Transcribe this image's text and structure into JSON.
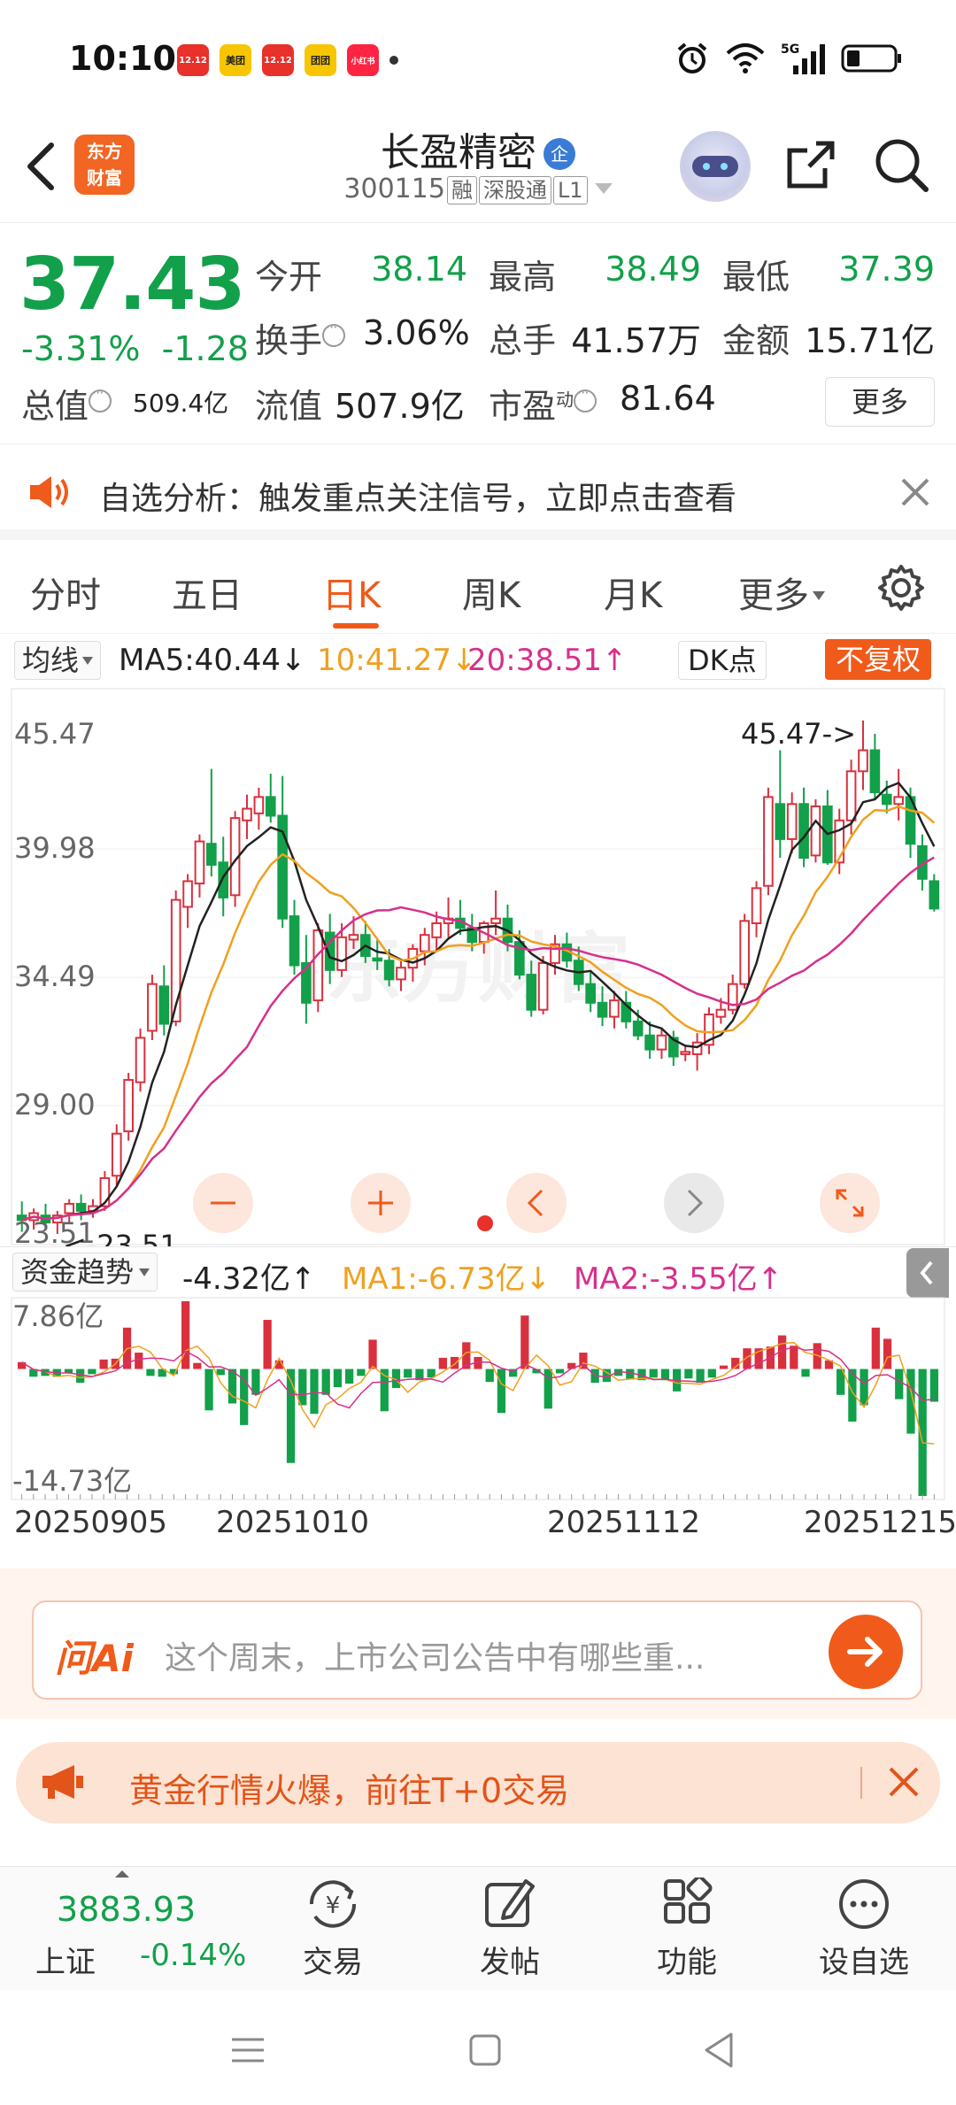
{
  "status_bar": {
    "time": "10:10",
    "app_icons": [
      {
        "name": "app-1212-icon",
        "label": "12.12",
        "color": "#e8312a"
      },
      {
        "name": "meituan-icon",
        "label": "美团",
        "color": "#f7c600"
      },
      {
        "name": "app-1212b-icon",
        "label": "12.12",
        "color": "#e8312a"
      },
      {
        "name": "tuantuan-icon",
        "label": "团团",
        "color": "#f7c600"
      },
      {
        "name": "xiaohongshu-icon",
        "label": "小红书",
        "color": "#ff2442"
      }
    ],
    "network": "5G"
  },
  "header": {
    "logo_line1": "东方",
    "logo_line2": "财富",
    "stock_name": "长盈精密",
    "badge": "企",
    "code": "300115",
    "tags": [
      "融",
      "深股通",
      "L1"
    ]
  },
  "quote": {
    "price": "37.43",
    "change_pct": "-3.31%",
    "change": "-1.28",
    "open_label": "今开",
    "open": "38.14",
    "high_label": "最高",
    "high": "38.49",
    "low_label": "最低",
    "low": "37.39",
    "turnover_label": "换手",
    "turnover": "3.06%",
    "volume_label": "总手",
    "volume": "41.57万",
    "amount_label": "金额",
    "amount": "15.71亿",
    "mktcap_label": "总值",
    "mktcap": "509.4亿",
    "float_label": "流值",
    "float": "507.9亿",
    "pe_label": "市盈",
    "pe_sup": "动",
    "pe": "81.64",
    "more": "更多"
  },
  "alert": {
    "text": "自选分析：触发重点关注信号，立即点击查看"
  },
  "tabs": [
    {
      "label": "分时",
      "active": false
    },
    {
      "label": "五日",
      "active": false
    },
    {
      "label": "日K",
      "active": true
    },
    {
      "label": "周K",
      "active": false
    },
    {
      "label": "月K",
      "active": false
    },
    {
      "label": "更多",
      "active": false
    }
  ],
  "ma_legend": {
    "button": "均线",
    "ma5": "MA5:40.44↓",
    "ma10": "10:41.27↓",
    "ma20": "20:38.51↑",
    "dk": "DK点",
    "adjust": "不复权"
  },
  "chart_data": {
    "type": "candlestick",
    "y_ticks": [
      "45.47",
      "39.98",
      "34.49",
      "29.00",
      "23.51"
    ],
    "ylim": [
      23.51,
      45.47
    ],
    "max_label": "45.47->",
    "min_label": "<-23.51",
    "watermark": "东方财富",
    "x_labels": [
      "20250905",
      "20251010",
      "20251112",
      "20251215"
    ],
    "colors": {
      "up": "#d9303e",
      "down": "#12a04a",
      "ma5": "#222222",
      "ma10": "#f0a020",
      "ma20": "#d6308c"
    },
    "candles": [
      [
        24.3,
        24.9,
        23.6,
        24.1
      ],
      [
        24.1,
        24.6,
        23.7,
        24.4
      ],
      [
        24.3,
        24.8,
        23.9,
        24.0
      ],
      [
        24.0,
        24.5,
        23.51,
        24.3
      ],
      [
        24.4,
        25.0,
        24.0,
        24.8
      ],
      [
        24.8,
        25.2,
        24.1,
        24.5
      ],
      [
        24.5,
        25.0,
        24.2,
        24.7
      ],
      [
        24.7,
        26.2,
        24.5,
        25.9
      ],
      [
        26.0,
        28.2,
        25.6,
        27.8
      ],
      [
        27.9,
        30.4,
        27.5,
        30.1
      ],
      [
        30.0,
        32.3,
        29.6,
        31.9
      ],
      [
        32.2,
        34.6,
        31.8,
        34.2
      ],
      [
        34.1,
        35.0,
        32.0,
        32.5
      ],
      [
        32.6,
        38.2,
        32.4,
        37.8
      ],
      [
        37.5,
        38.9,
        36.6,
        38.6
      ],
      [
        38.5,
        40.6,
        37.9,
        40.3
      ],
      [
        40.2,
        43.4,
        38.8,
        39.3
      ],
      [
        39.4,
        40.5,
        37.1,
        37.9
      ],
      [
        38.0,
        41.6,
        37.5,
        41.3
      ],
      [
        41.2,
        42.3,
        40.4,
        41.7
      ],
      [
        41.5,
        42.6,
        40.8,
        42.2
      ],
      [
        42.2,
        43.2,
        41.1,
        41.4
      ],
      [
        41.4,
        43.1,
        36.6,
        37.0
      ],
      [
        37.1,
        37.8,
        34.6,
        35.0
      ],
      [
        35.1,
        36.3,
        32.5,
        33.4
      ],
      [
        33.5,
        36.8,
        33.0,
        36.5
      ],
      [
        36.4,
        37.2,
        34.2,
        34.8
      ],
      [
        34.8,
        36.8,
        34.5,
        36.2
      ],
      [
        36.1,
        37.1,
        35.7,
        36.3
      ],
      [
        36.3,
        36.9,
        35.1,
        35.4
      ],
      [
        35.3,
        36.1,
        34.8,
        35.2
      ],
      [
        35.2,
        35.7,
        34.1,
        34.4
      ],
      [
        34.4,
        35.2,
        33.9,
        34.9
      ],
      [
        34.9,
        35.9,
        34.3,
        35.7
      ],
      [
        35.6,
        36.6,
        35.0,
        36.3
      ],
      [
        36.2,
        37.3,
        35.6,
        36.8
      ],
      [
        36.8,
        37.9,
        36.2,
        37.0
      ],
      [
        37.0,
        37.8,
        36.3,
        36.6
      ],
      [
        36.6,
        37.2,
        35.6,
        36.0
      ],
      [
        36.0,
        36.9,
        35.5,
        36.8
      ],
      [
        36.8,
        38.2,
        36.3,
        37.0
      ],
      [
        37.0,
        37.6,
        35.6,
        36.0
      ],
      [
        36.0,
        36.5,
        34.4,
        34.6
      ],
      [
        34.6,
        35.2,
        32.8,
        33.1
      ],
      [
        33.1,
        35.4,
        32.9,
        35.1
      ],
      [
        35.1,
        36.3,
        34.6,
        35.9
      ],
      [
        35.9,
        36.4,
        34.9,
        35.2
      ],
      [
        35.2,
        35.8,
        33.9,
        34.2
      ],
      [
        34.2,
        34.7,
        33.0,
        33.4
      ],
      [
        33.4,
        34.1,
        32.4,
        32.8
      ],
      [
        32.8,
        33.9,
        32.3,
        33.5
      ],
      [
        33.4,
        33.9,
        32.3,
        32.6
      ],
      [
        32.6,
        33.1,
        31.8,
        32.0
      ],
      [
        32.0,
        32.6,
        31.0,
        31.4
      ],
      [
        31.4,
        32.3,
        31.0,
        32.0
      ],
      [
        31.9,
        32.2,
        30.7,
        31.1
      ],
      [
        31.2,
        31.6,
        30.9,
        31.3
      ],
      [
        31.2,
        32.1,
        30.5,
        31.7
      ],
      [
        31.6,
        33.2,
        31.2,
        32.9
      ],
      [
        32.8,
        33.6,
        32.5,
        33.1
      ],
      [
        33.1,
        34.6,
        32.9,
        34.2
      ],
      [
        34.2,
        37.2,
        34.0,
        36.9
      ],
      [
        36.8,
        38.6,
        36.2,
        38.3
      ],
      [
        38.4,
        42.6,
        38.0,
        42.2
      ],
      [
        41.9,
        44.2,
        39.6,
        40.4
      ],
      [
        40.4,
        42.4,
        39.8,
        41.9
      ],
      [
        41.9,
        42.6,
        39.2,
        39.6
      ],
      [
        39.7,
        42.1,
        39.4,
        41.8
      ],
      [
        41.8,
        42.5,
        39.3,
        39.4
      ],
      [
        39.4,
        41.7,
        38.9,
        41.2
      ],
      [
        41.2,
        43.8,
        40.6,
        43.3
      ],
      [
        43.3,
        45.47,
        42.5,
        44.2
      ],
      [
        44.2,
        44.9,
        42.1,
        42.4
      ],
      [
        42.3,
        42.9,
        41.5,
        41.9
      ],
      [
        41.9,
        43.4,
        41.2,
        42.2
      ],
      [
        42.2,
        42.6,
        39.6,
        40.2
      ],
      [
        40.1,
        40.6,
        38.2,
        38.7
      ],
      [
        38.6,
        38.9,
        37.3,
        37.43
      ]
    ]
  },
  "fund": {
    "button": "资金趋势",
    "value": "-4.32亿↑",
    "ma1": "MA1:-6.73亿↓",
    "ma2": "MA2:-3.55亿↑",
    "ytop": "7.86亿",
    "ybottom": "-14.73亿",
    "bars": [
      0.8,
      -0.9,
      -0.8,
      -0.9,
      -0.5,
      -1.6,
      -0.6,
      1.1,
      1.2,
      4.8,
      1.9,
      -0.8,
      -0.9,
      -0.6,
      7.86,
      0.7,
      -4.8,
      -0.7,
      -4.0,
      -6.5,
      -3.0,
      5.7,
      1.0,
      -10.9,
      -4.2,
      -5.2,
      -3.0,
      -2.1,
      -1.7,
      -0.8,
      3.4,
      -4.9,
      -2.2,
      -1.0,
      -1.3,
      -1.0,
      1.3,
      1.4,
      3.1,
      1.4,
      -1.5,
      -5.1,
      -0.9,
      6.2,
      -0.5,
      -4.6,
      -0.5,
      0.7,
      1.9,
      -1.6,
      -1.5,
      -0.8,
      -1.2,
      -1.3,
      -1.0,
      -1.3,
      -2.6,
      -1.1,
      -1.6,
      -1.0,
      0.4,
      1.3,
      2.4,
      2.4,
      2.6,
      3.9,
      2.7,
      -0.9,
      3.0,
      1.0,
      -3.0,
      -6.1,
      -4.2,
      4.8,
      3.5,
      -3.5,
      -7.5,
      -14.73,
      -3.8
    ]
  },
  "ai": {
    "logo": "问Ai",
    "placeholder": "这个周末，上市公司公告中有哪些重..."
  },
  "gold_banner": {
    "text": "黄金行情火爆，前往T+0交易"
  },
  "bottom_bar": {
    "index_value": "3883.93",
    "index_name": "上证",
    "index_change": "-0.14%",
    "nav": [
      {
        "label": "交易",
        "icon": "trade-icon"
      },
      {
        "label": "发帖",
        "icon": "post-icon"
      },
      {
        "label": "功能",
        "icon": "apps-icon"
      },
      {
        "label": "设自选",
        "icon": "more-circle-icon"
      }
    ]
  }
}
